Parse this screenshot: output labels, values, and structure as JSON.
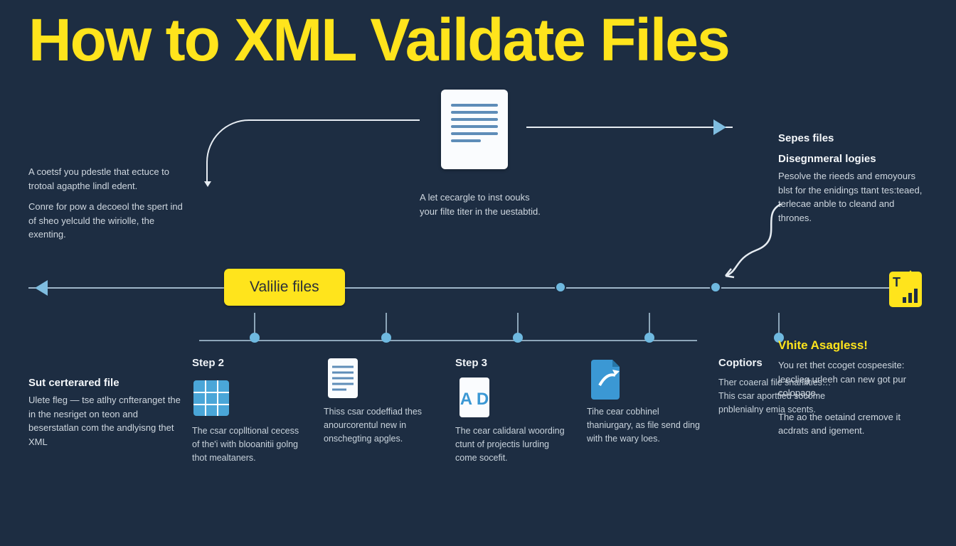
{
  "title": "How to XML Vaildate Files",
  "introLeft": {
    "p1": "A coetsf you pdestle that ectuce to trotoal agapthe lindl edent.",
    "p2": "Conre for pow a decoeol the spert ind of sheo yelculd the wiriolle, the exenting."
  },
  "docCaption": "A let cecargle to inst oouks your filte titer in the uestabtid.",
  "rightBlock": {
    "h1": "Sepes files",
    "h2": "Disegnmeral logies",
    "body": "Pesolve the rieeds and emoyours blst for the enidings ttant tes:teaed, terlecae anble to cleand and thrones."
  },
  "pill": "Valilie files",
  "endBadge": "T",
  "bottomLeft": {
    "h": "Sut certerared file",
    "body": "Ulete fleg — tse atlhy cnfteranget the in the nesriget on teon and beserstatlan com the andlyisng thet XML"
  },
  "steps": [
    {
      "title": "Step 2",
      "body": "The csar coplltional cecess of the'i with blooanitii golng thot mealtaners."
    },
    {
      "title": "",
      "body": "Thiss csar codeffiad thes anourcorentul new in onschegting apgles."
    },
    {
      "title": "Step 3",
      "body": "The cear calidaral woording ctunt of projectis lurding come socefit."
    },
    {
      "title": "",
      "body": "Tihe cear cobhinel thaniurgary, as file send ding with the wary loes."
    },
    {
      "title": "Coptiors",
      "body": "Ther coaeral file snarlifties…\nThis csar aporttied socome pnblenialny emia scents."
    }
  ],
  "rightBottom": {
    "yh": "Vhite Asagless!",
    "p1": "You ret thet ccoget cospeesite: leeclieg urleeh can new got pur colopage.",
    "p2": "The ao the oetaind cremove it acdrats and igement."
  }
}
